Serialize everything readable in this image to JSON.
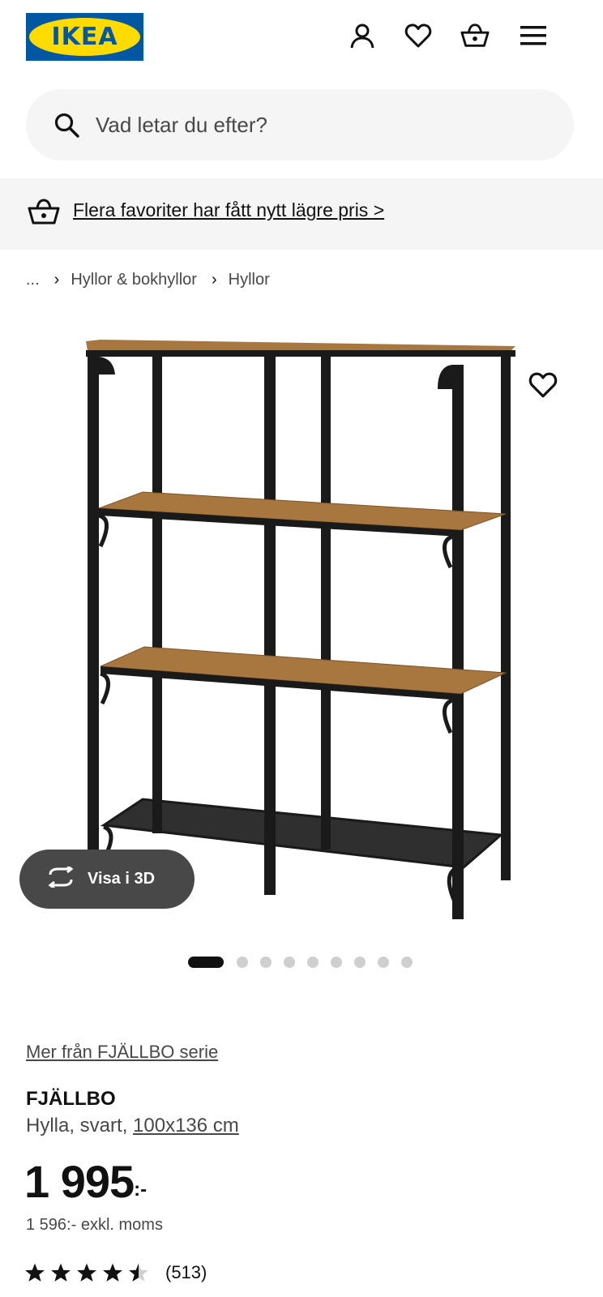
{
  "header": {
    "logo_text": "IKEA",
    "icons": [
      "profile-icon",
      "heart-icon",
      "basket-icon",
      "menu-icon"
    ]
  },
  "search": {
    "placeholder": "Vad letar du efter?"
  },
  "banner": {
    "text": "Flera favoriter har fått nytt lägre pris >"
  },
  "breadcrumb": {
    "items": [
      "...",
      "Hyllor & bokhyllor",
      "Hyllor"
    ]
  },
  "gallery": {
    "view_3d_label": "Visa i 3D",
    "dots_total": 10,
    "active_index": 0
  },
  "product": {
    "series_link": "Mer från FJÄLLBO serie",
    "name": "FJÄLLBO",
    "desc_prefix": "Hylla, svart, ",
    "size": "100x136 cm",
    "price": "1 995",
    "price_suffix": ":-",
    "price_ex_vat": "1 596:- exkl. moms",
    "rating": 4.5,
    "rating_count": "(513)"
  },
  "colors": {
    "brand_blue": "#0058a3",
    "brand_yellow": "#ffdb00",
    "wood": "#a8773f",
    "frame": "#1a1a1a"
  }
}
